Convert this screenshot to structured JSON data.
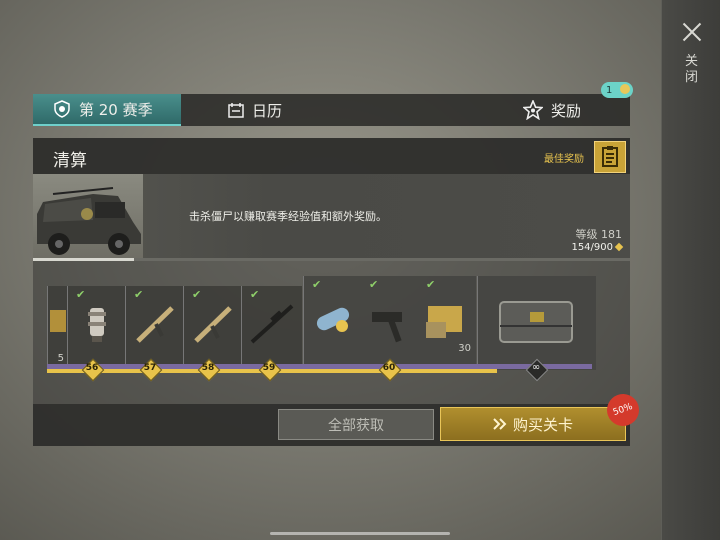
{
  "close": {
    "label": "关闭"
  },
  "tabs": [
    {
      "label": "第 20 赛季",
      "icon": "season-shield-icon"
    },
    {
      "label": "日历",
      "icon": "calendar-icon"
    },
    {
      "label": "奖励",
      "icon": "star-icon",
      "badge": "1"
    }
  ],
  "panel": {
    "title": "清算",
    "best_reward_label": "最佳奖励",
    "description": "击杀僵尸以赚取赛季经验值和额外奖励。",
    "level_text": "等级 181",
    "xp_text": "154/900",
    "xp_progress": 0.17
  },
  "rewards": {
    "partial_qty": "5",
    "items": [
      {
        "item": "scope-part",
        "level": "56",
        "claimed": true
      },
      {
        "item": "rifle",
        "level": "57",
        "claimed": true
      },
      {
        "item": "rifle",
        "level": "58",
        "claimed": true
      },
      {
        "item": "sniper-rifle",
        "level": "59",
        "claimed": true
      },
      {
        "item": "fuel-canister",
        "level": "",
        "claimed": true
      },
      {
        "item": "smg",
        "level": "60",
        "claimed": true
      },
      {
        "item": "ammo-crate",
        "level": "",
        "claimed": true,
        "qty": "30"
      },
      {
        "item": "weapon-case",
        "level": "∞",
        "claimed": false
      }
    ]
  },
  "buttons": {
    "claim_all": "全部获取",
    "buy_pass": "购买关卡",
    "sale": "50%"
  },
  "colors": {
    "accent": "#e8c34a",
    "tab_active": "#3f8583",
    "check": "#8fd06a"
  }
}
